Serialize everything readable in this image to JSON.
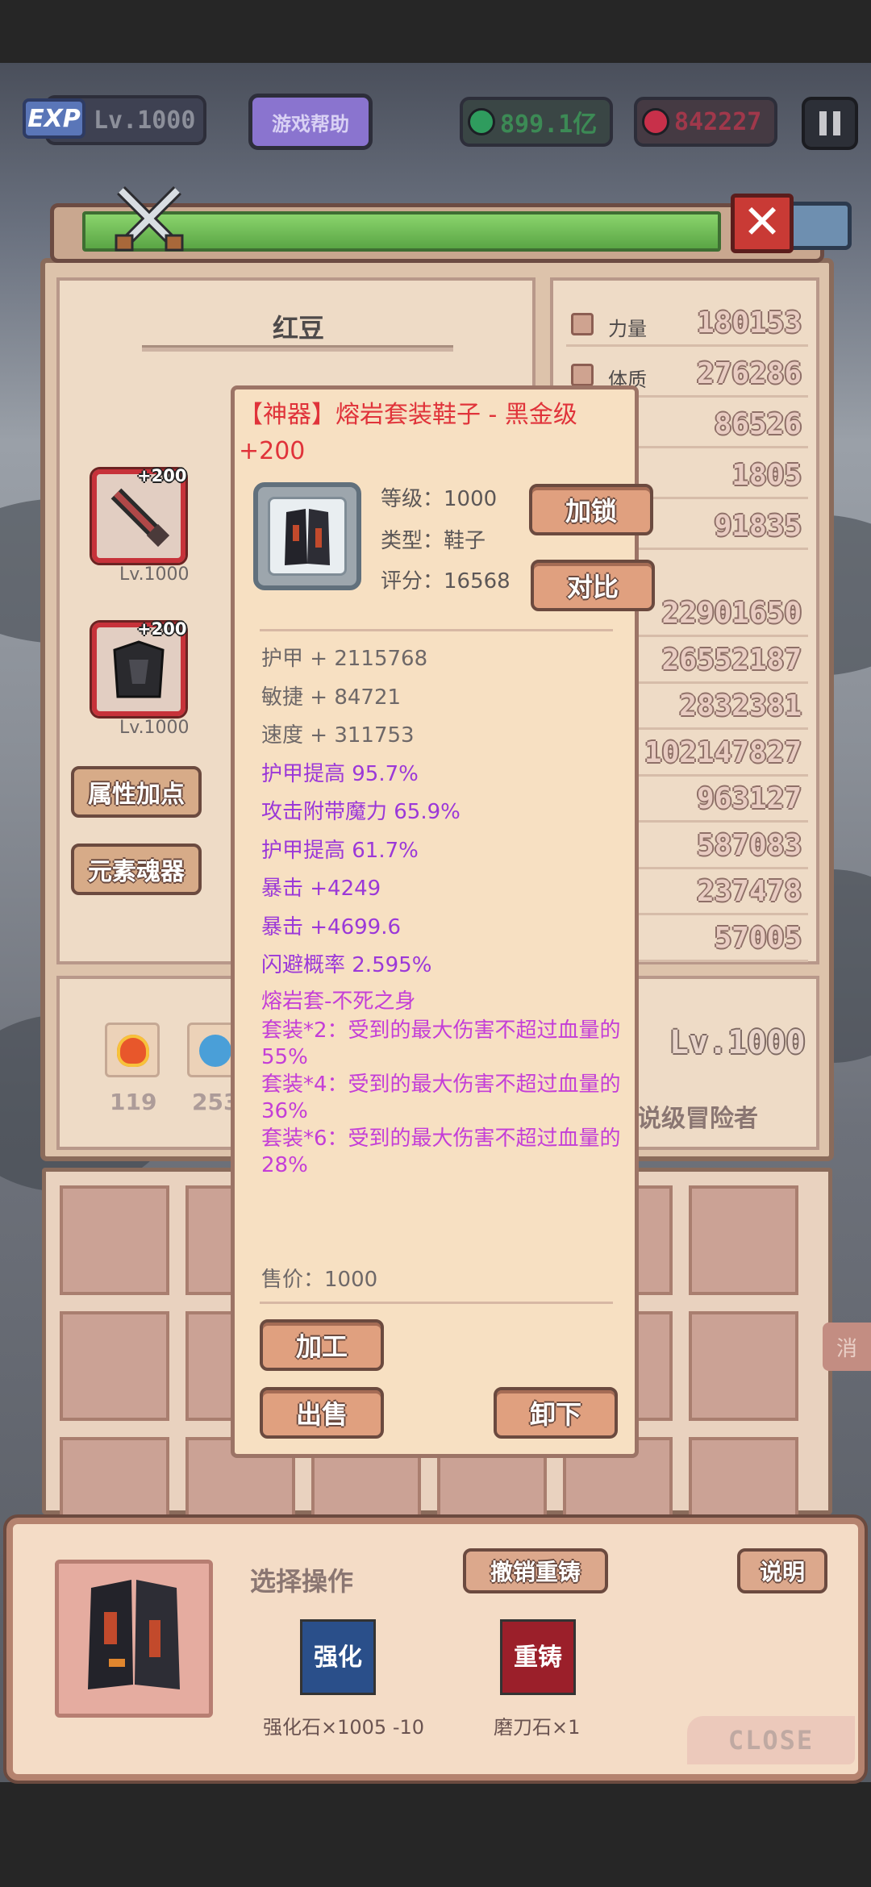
{
  "hud": {
    "exp_badge": "EXP",
    "level": "Lv.1000",
    "help_button": "游戏帮助",
    "gems": "899.1亿",
    "rubies": "842227"
  },
  "character": {
    "name": "红豆",
    "slots": [
      {
        "plus": "+200",
        "level": "Lv.1000",
        "icon": "sword-icon"
      },
      {
        "plus": "+200",
        "level": "Lv.1000",
        "icon": "armor-icon"
      }
    ],
    "buttons": {
      "attr_points": "属性加点",
      "element_soul": "元素魂器"
    }
  },
  "stats": {
    "primary": [
      {
        "label": "力量",
        "value": "180153"
      },
      {
        "label": "体质",
        "value": "276286"
      },
      {
        "label": "",
        "value": "86526"
      },
      {
        "label": "",
        "value": "1805"
      },
      {
        "label": "",
        "value": "91835"
      }
    ],
    "secondary": [
      "22901650",
      "26552187",
      "2832381",
      "102147827",
      "963127",
      "587083",
      "237478",
      "57005"
    ]
  },
  "elements": [
    {
      "count": "119",
      "color": "#e8572b"
    },
    {
      "count": "253",
      "color": "#4a9fd8"
    }
  ],
  "profile": {
    "level": "Lv.1000",
    "rank": "说级冒险者"
  },
  "item": {
    "title": "【神器】熔岩套装鞋子 - 黑金级 +200",
    "level_line": "等级：1000",
    "type_line": "类型：鞋子",
    "score_line": "评分：16568",
    "lock_button": "加锁",
    "compare_button": "对比",
    "base_attrs": [
      "护甲 + 2115768",
      "敏捷 + 84721",
      "速度 + 311753"
    ],
    "bonus_attrs": [
      "护甲提高 95.7%",
      "攻击附带魔力 65.9%",
      "护甲提高 61.7%",
      "暴击 +4249",
      "暴击 +4699.6",
      "闪避概率 2.595%"
    ],
    "set_name": "熔岩套-不死之身",
    "set_bonuses": [
      "套装*2：受到的最大伤害不超过血量的55%",
      "套装*4：受到的最大伤害不超过血量的36%",
      "套装*6：受到的最大伤害不超过血量的28%"
    ],
    "price": "售价：1000",
    "craft_button": "加工",
    "sell_button": "出售",
    "unequip_button": "卸下"
  },
  "inventory": {
    "cancel_tab": "消"
  },
  "bottom": {
    "select_op": "选择操作",
    "undo_button": "撤销重铸",
    "explain_button": "说明",
    "materials": [
      {
        "label": "强化石×1005 -10",
        "icon_text": "强化",
        "icon": "enhance-stone-icon"
      },
      {
        "label": "磨刀石×1",
        "icon_text": "重铸",
        "icon": "whetstone-icon"
      }
    ],
    "close": "CLOSE"
  },
  "colors": {
    "rare_title": "#e0333a",
    "bonus_attr": "#9b38d8",
    "set_text": "#c43ed7"
  }
}
